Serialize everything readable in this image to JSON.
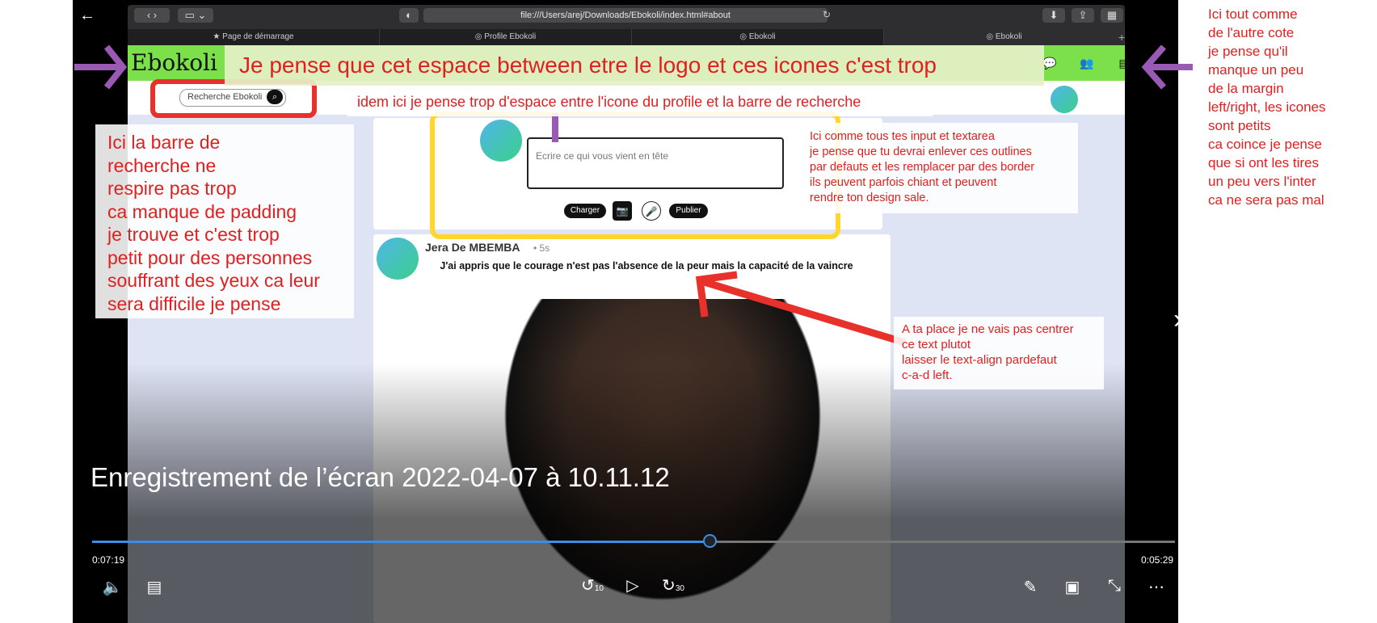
{
  "browser": {
    "url": "file:///Users/arej/Downloads/Ebokoli/index.html#about",
    "tabs": [
      "Page de démarrage",
      "Profile Ebokoli",
      "Ebokoli",
      "Ebokoli"
    ],
    "new_tab": "+"
  },
  "site": {
    "logo": "Ebokoli",
    "search_placeholder": "Recherche Ebokoli",
    "compose_placeholder": "Ecrire ce qui vous vient en tête",
    "compose_buttons": {
      "upload": "Charger",
      "publish": "Publier"
    },
    "post": {
      "author": "Jera De MBEMBA",
      "time": "• 5s",
      "text": "J'ai appris que le courage n'est pas l'absence de la peur mais la capacité de la vaincre"
    }
  },
  "annotations": {
    "center": "Je pense que cet espace between etre le logo et ces icones c'est trop",
    "right": "Ici tout comme\nde l'autre cote\nje pense qu'il\nmanque un peu\nde la margin\nleft/right, les icones\nsont petits\nca coince je pense\nque si ont les tires\nun peu vers l'inter\nca ne sera pas mal",
    "left": "Ici la barre de\nrecherche ne\nrespire pas trop\nca manque de padding\nje trouve et c'est trop\npetit pour des personnes\nsouffrant des yeux ca leur\nsera difficile je pense",
    "topmid": "idem ici je pense trop d'espace entre l'icone du profile et la barre de recherche",
    "textarea": "Ici comme tous tes input et textarea\nje pense que tu devrai enlever ces outlines\npar defauts et les remplacer par des border\nils peuvent parfois chiant et peuvent\nrendre ton design sale.",
    "text_align": "A ta place je ne vais pas centrer\nce text plutot\nlaisser le text-align pardefaut\nc-a-d left."
  },
  "player": {
    "title": "Enregistrement de l’écran 2022-04-07 à 10.11.12",
    "elapsed": "0:07:19",
    "remaining": "0:05:29",
    "progress": 0.57,
    "skip_back": "10",
    "skip_forward": "30"
  },
  "colors": {
    "accent": "#3a8ee6",
    "header": "#7be04a",
    "annotation": "#e02020"
  }
}
